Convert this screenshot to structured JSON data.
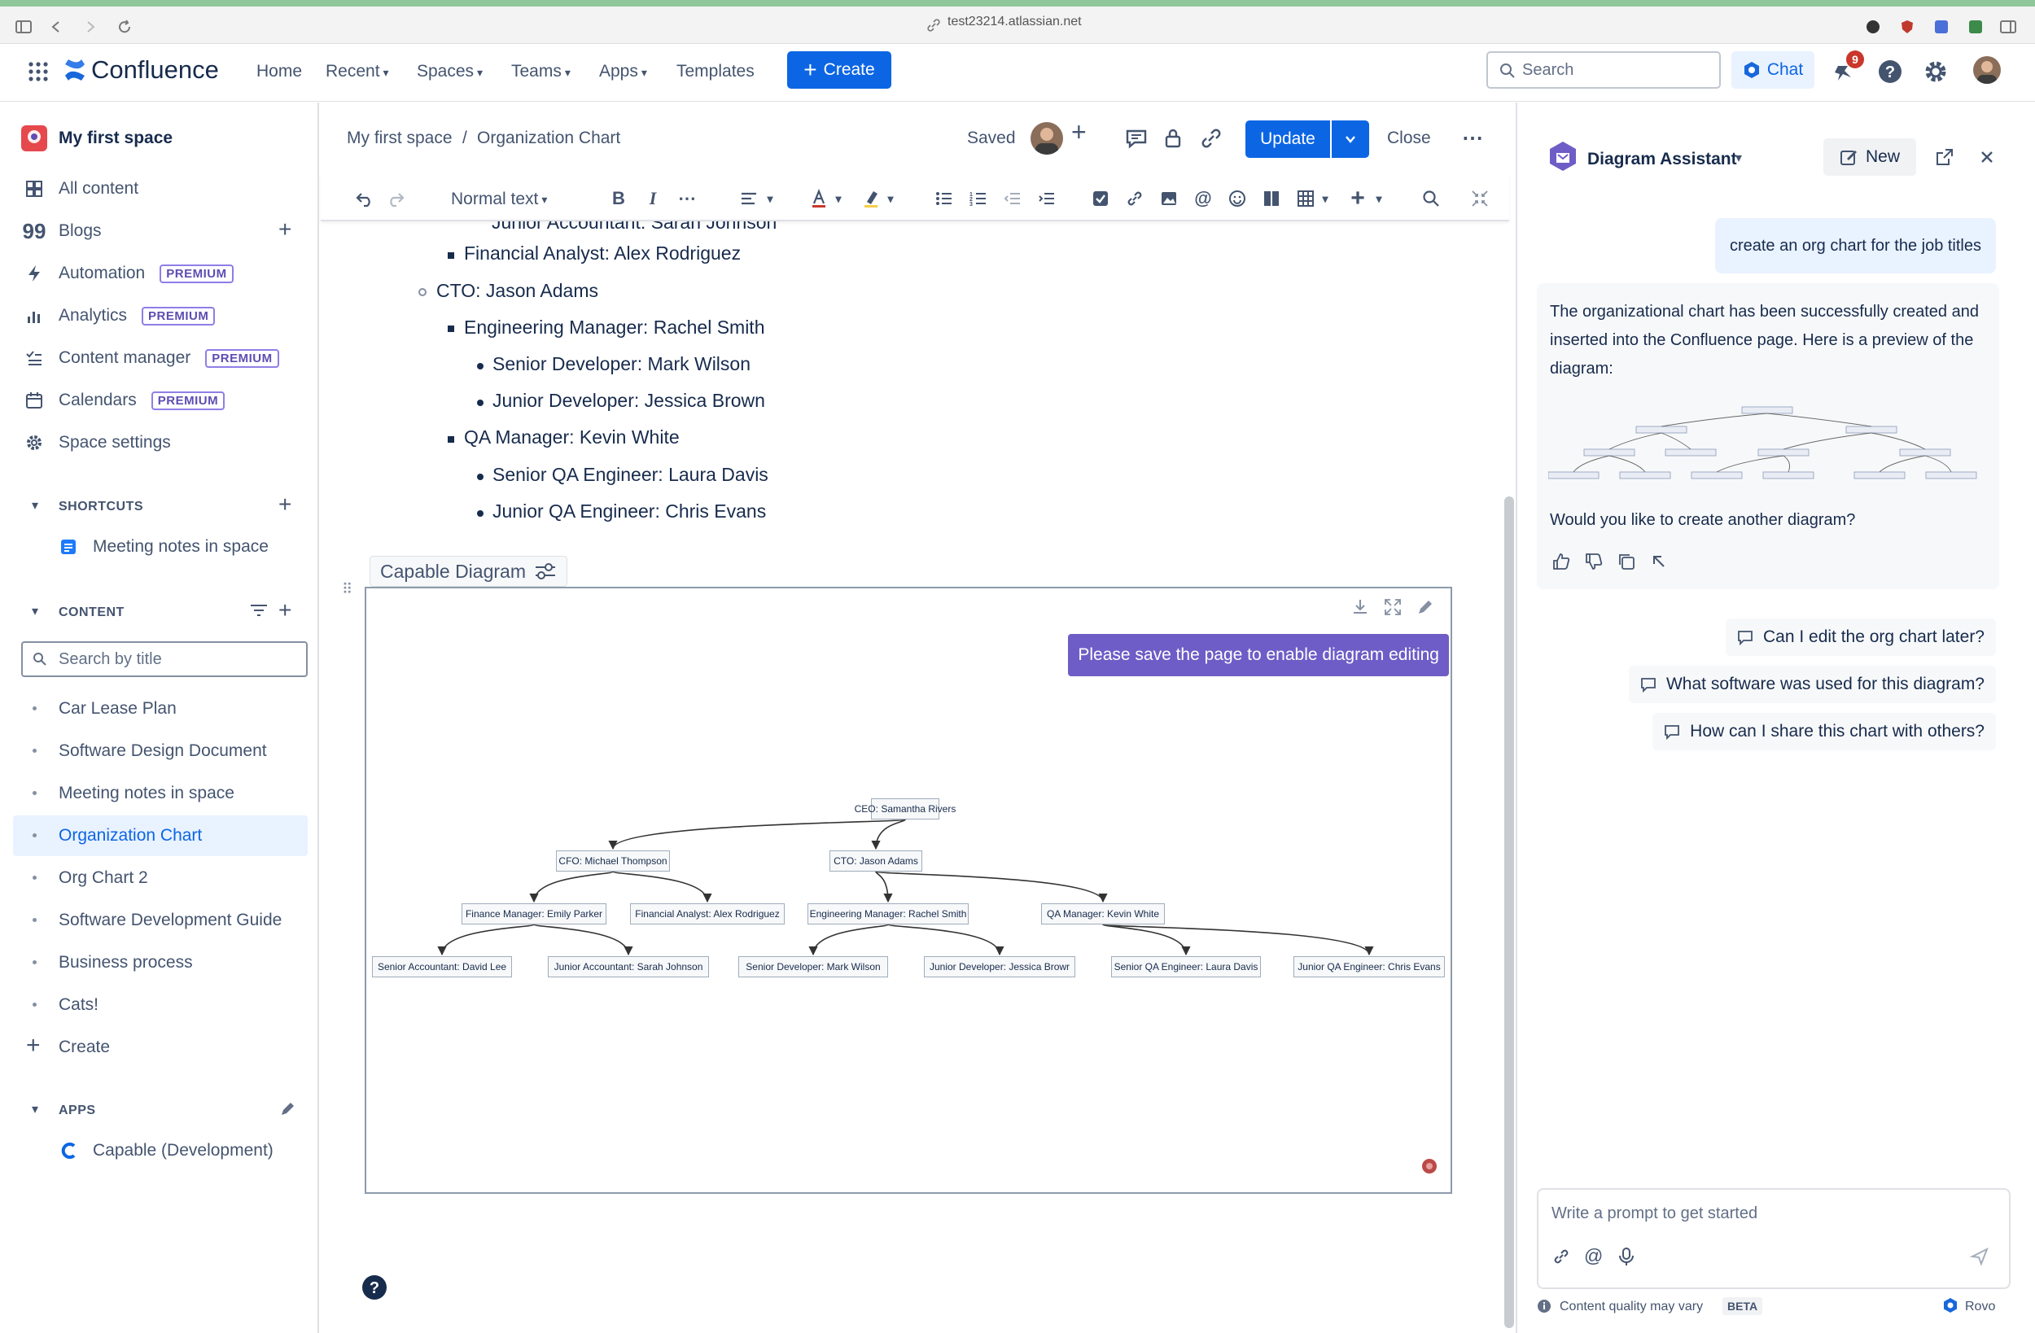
{
  "browser": {
    "url": "test23214.atlassian.net"
  },
  "topnav": {
    "product": "Confluence",
    "items": [
      {
        "label": "Home"
      },
      {
        "label": "Recent"
      },
      {
        "label": "Spaces"
      },
      {
        "label": "Teams"
      },
      {
        "label": "Apps"
      },
      {
        "label": "Templates"
      }
    ],
    "create_label": "Create",
    "search_placeholder": "Search",
    "chat_label": "Chat",
    "notification_count": "9"
  },
  "sidebar": {
    "space_name": "My first space",
    "links": [
      {
        "label": "All content",
        "icon": "all-content-icon",
        "premium": ""
      },
      {
        "label": "Blogs",
        "icon": "blogs-icon",
        "premium": ""
      },
      {
        "label": "Automation",
        "icon": "automation-icon",
        "premium": "PREMIUM"
      },
      {
        "label": "Analytics",
        "icon": "analytics-icon",
        "premium": "PREMIUM"
      },
      {
        "label": "Content manager",
        "icon": "content-manager-icon",
        "premium": "PREMIUM"
      },
      {
        "label": "Calendars",
        "icon": "calendar-icon",
        "premium": "PREMIUM"
      },
      {
        "label": "Space settings",
        "icon": "gear-icon",
        "premium": ""
      }
    ],
    "shortcuts_heading": "SHORTCUTS",
    "shortcut_item": "Meeting notes in space",
    "content_heading": "CONTENT",
    "search_placeholder": "Search by title",
    "tree": [
      {
        "label": "Car Lease Plan"
      },
      {
        "label": "Software Design Document"
      },
      {
        "label": "Meeting notes in space"
      },
      {
        "label": "Organization Chart"
      },
      {
        "label": "Org Chart 2"
      },
      {
        "label": "Software Development Guide"
      },
      {
        "label": "Business process"
      },
      {
        "label": "Cats!"
      }
    ],
    "create_label": "Create",
    "apps_heading": "APPS",
    "app_item": "Capable (Development)"
  },
  "editor": {
    "breadcrumb_space": "My first space",
    "breadcrumb_sep": "/",
    "breadcrumb_page": "Organization Chart",
    "saved_label": "Saved",
    "update_label": "Update",
    "close_label": "Close",
    "text_style": "Normal text"
  },
  "document": {
    "lines": [
      {
        "text": "Junior Accountant: Sarah Johnson"
      },
      {
        "text": "Financial Analyst: Alex Rodriguez"
      },
      {
        "text": "CTO: Jason Adams"
      },
      {
        "text": "Engineering Manager: Rachel Smith"
      },
      {
        "text": "Senior Developer: Mark Wilson"
      },
      {
        "text": "Junior Developer: Jessica Brown"
      },
      {
        "text": "QA Manager: Kevin White"
      },
      {
        "text": "Senior QA Engineer: Laura Davis"
      },
      {
        "text": "Junior QA Engineer: Chris Evans"
      }
    ],
    "macro_label": "Capable Diagram",
    "save_tip": "Please save the page to enable diagram editing"
  },
  "org_chart": {
    "nodes": [
      {
        "id": "ceo",
        "label": "CEO: Samantha Rivers",
        "parent": ""
      },
      {
        "id": "cfo",
        "label": "CFO: Michael Thompson",
        "parent": "ceo"
      },
      {
        "id": "cto",
        "label": "CTO: Jason Adams",
        "parent": "ceo"
      },
      {
        "id": "fm",
        "label": "Finance Manager: Emily Parker",
        "parent": "cfo"
      },
      {
        "id": "fa",
        "label": "Financial Analyst: Alex Rodriguez",
        "parent": "cfo"
      },
      {
        "id": "em",
        "label": "Engineering Manager: Rachel Smith",
        "parent": "cto"
      },
      {
        "id": "qm",
        "label": "QA Manager: Kevin White",
        "parent": "cto"
      },
      {
        "id": "sa",
        "label": "Senior Accountant: David Lee",
        "parent": "fm"
      },
      {
        "id": "ja",
        "label": "Junior Accountant: Sarah Johnson",
        "parent": "fm"
      },
      {
        "id": "sd",
        "label": "Senior Developer: Mark Wilson",
        "parent": "em"
      },
      {
        "id": "jd",
        "label": "Junior Developer: Jessica Browr",
        "parent": "em"
      },
      {
        "id": "sq",
        "label": "Senior QA Engineer: Laura Davis",
        "parent": "qm"
      },
      {
        "id": "jq",
        "label": "Junior QA Engineer: Chris Evans",
        "parent": "qm"
      }
    ]
  },
  "assistant": {
    "title": "Diagram Assistant",
    "new_label": "New",
    "user_message": "create an org chart for the job titles",
    "ai_message": "The organizational chart has been successfully created and inserted into the Confluence page. Here is a preview of the diagram:",
    "ai_followup": "Would you like to create another diagram?",
    "suggestions": [
      {
        "label": "Can I edit the org chart later?"
      },
      {
        "label": "What software was used for this diagram?"
      },
      {
        "label": "How can I share this chart with others?"
      }
    ],
    "prompt_placeholder": "Write a prompt to get started",
    "footer_note": "Content quality may vary",
    "beta_label": "BETA",
    "rovo_label": "Rovo"
  },
  "colors": {
    "brand": "#0c66e4",
    "assistant_purple": "#6e5dc6",
    "premium_purple": "#5e4db2"
  }
}
